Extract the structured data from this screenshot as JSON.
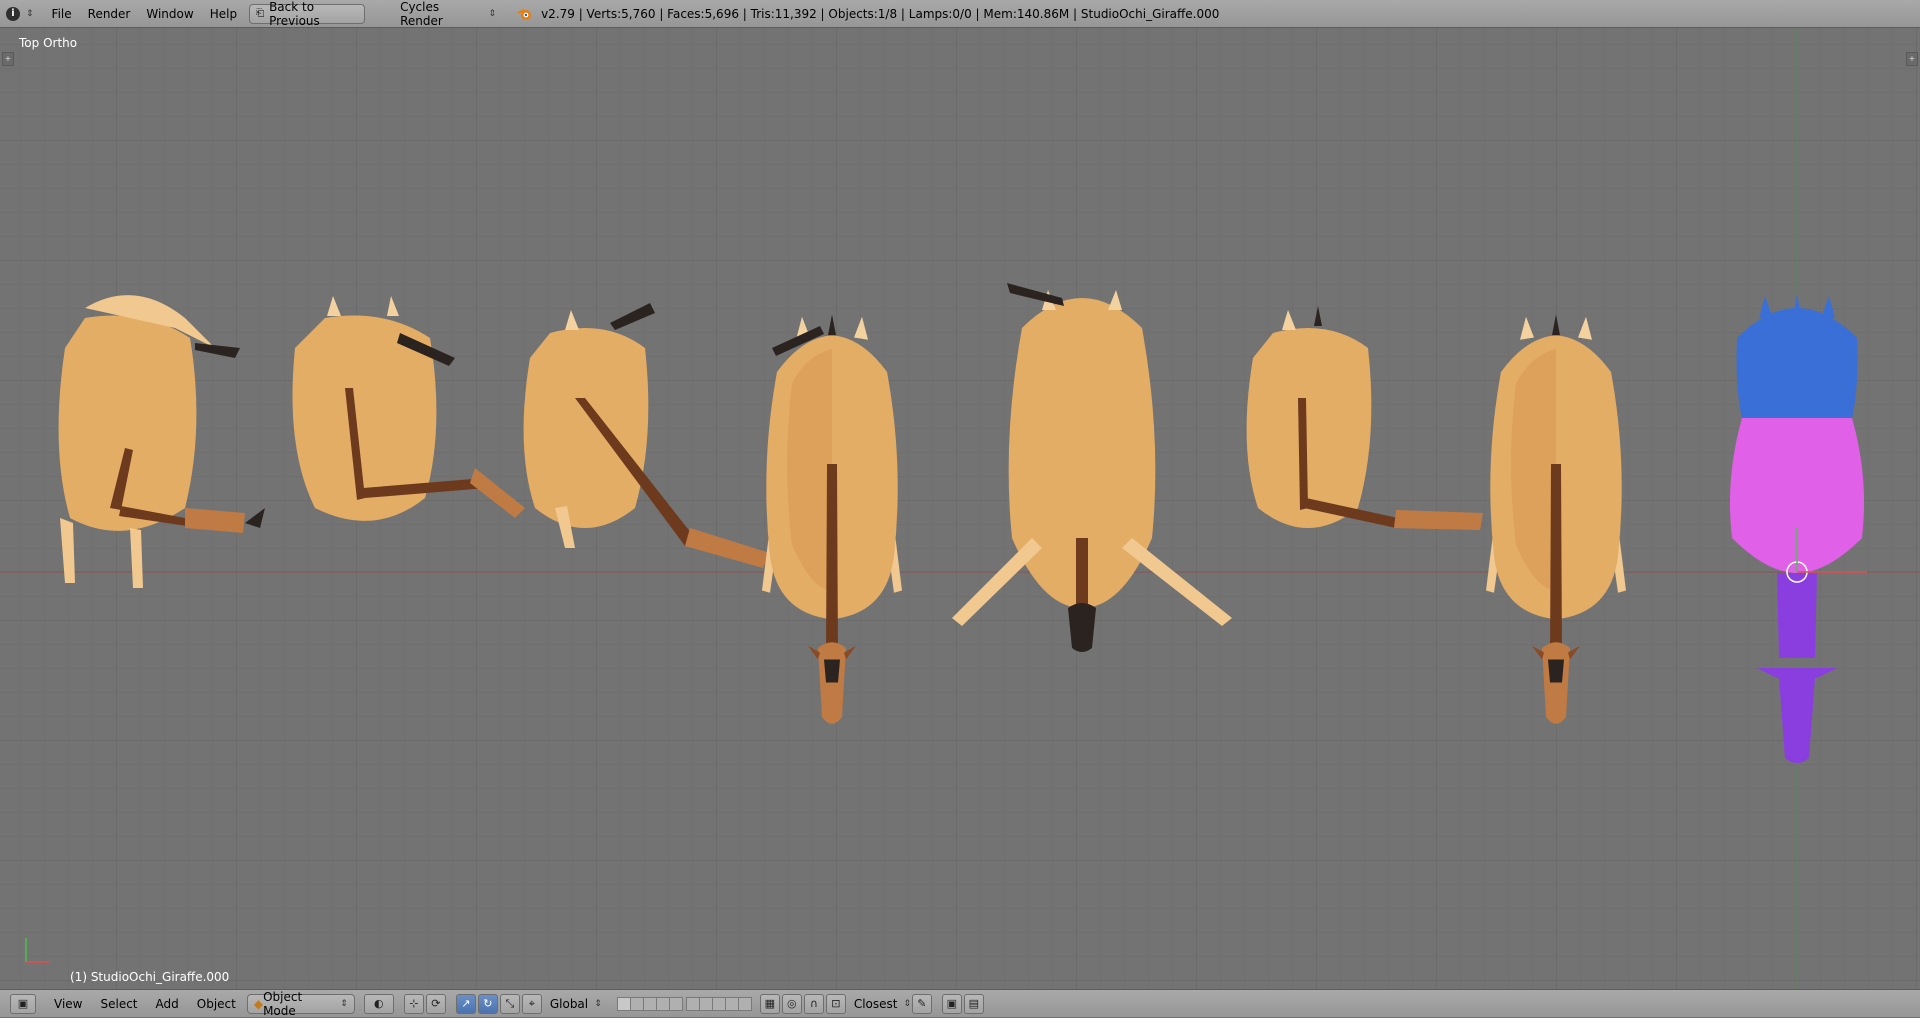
{
  "header": {
    "menus": [
      "File",
      "Render",
      "Window",
      "Help"
    ],
    "back_button": "Back to Previous",
    "render_engine": "Cycles Render",
    "stats": "v2.79 | Verts:5,760 | Faces:5,696 | Tris:11,392 | Objects:1/8 | Lamps:0/0 | Mem:140.86M | StudioOchi_Giraffe.000"
  },
  "viewport": {
    "view_name": "Top Ortho",
    "active_object": "(1) StudioOchi_Giraffe.000",
    "model_count": 8
  },
  "footer": {
    "view": "View",
    "select": "Select",
    "add": "Add",
    "object": "Object",
    "mode": "Object Mode",
    "orientation": "Global",
    "snap_target": "Closest"
  },
  "colors": {
    "giraffe_body": "#e0a860",
    "giraffe_mane": "#6e3a1e",
    "weight_blue": "#3a6fd8",
    "weight_magenta": "#e060e8",
    "weight_purple": "#8a3ee0"
  }
}
